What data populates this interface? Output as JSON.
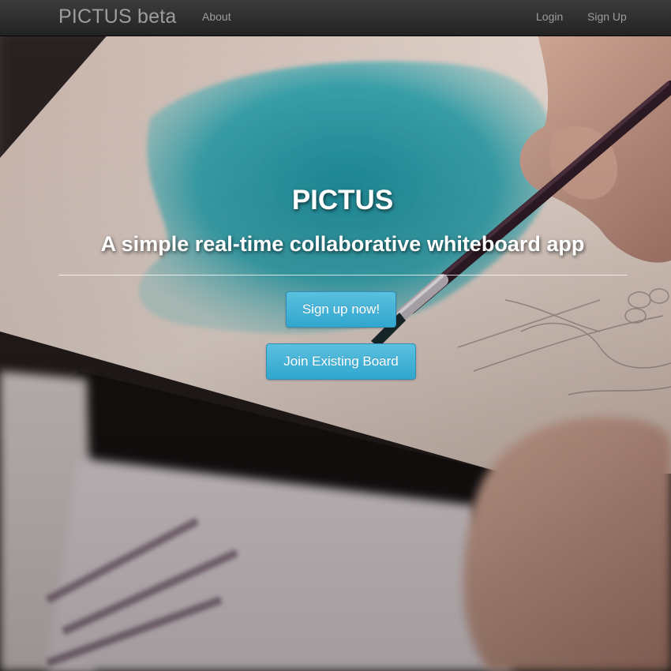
{
  "navbar": {
    "brand": "PICTUS beta",
    "links": {
      "about": "About",
      "login": "Login",
      "signup": "Sign Up"
    }
  },
  "hero": {
    "title": "PICTUS",
    "subtitle": "A simple real-time collaborative whiteboard app",
    "primary_button": "Sign up now!",
    "secondary_button": "Join Existing Board"
  },
  "colors": {
    "navbar": "#222222",
    "nav_text": "#9d9d9d",
    "button": "#5bc0de",
    "hero_text": "#ffffff"
  },
  "background": {
    "description_icon": "painting-photo"
  }
}
